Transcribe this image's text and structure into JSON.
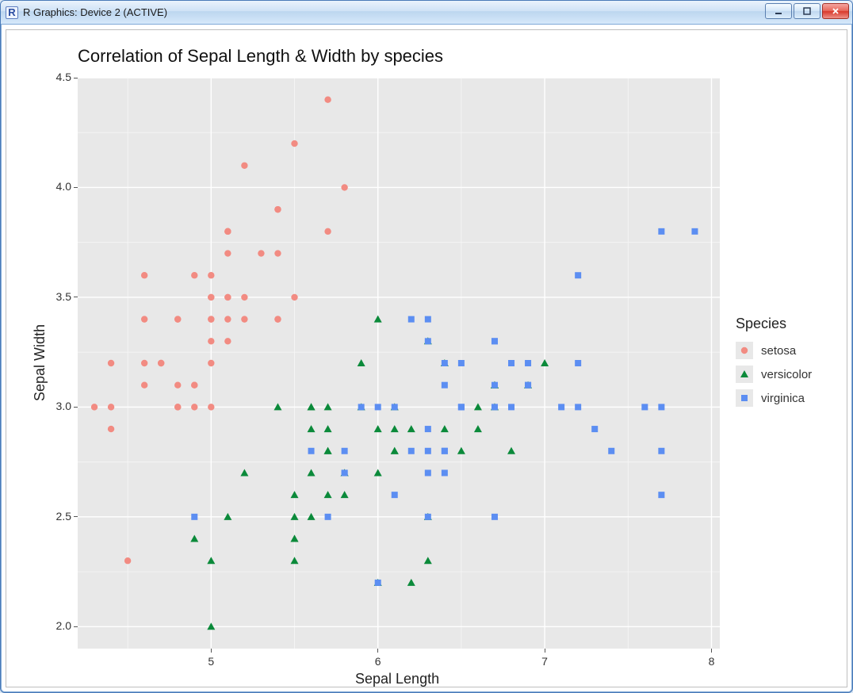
{
  "window": {
    "title": "R Graphics: Device 2 (ACTIVE)",
    "icon_label": "R"
  },
  "chart_data": {
    "type": "scatter",
    "title": "Correlation of Sepal Length & Width by species",
    "xlabel": "Sepal Length",
    "ylabel": "Sepal Width",
    "xlim": [
      4.2,
      8.05
    ],
    "ylim": [
      1.9,
      4.5
    ],
    "x_ticks": [
      5,
      6,
      7,
      8
    ],
    "x_tick_labels": [
      "5",
      "6",
      "7",
      "8"
    ],
    "y_ticks": [
      2.0,
      2.5,
      3.0,
      3.5,
      4.0,
      4.5
    ],
    "y_tick_labels": [
      "2.0",
      "2.5",
      "3.0",
      "3.5",
      "4.0",
      "4.5"
    ],
    "x_minor": [
      4.5,
      5.5,
      6.5,
      7.5
    ],
    "y_minor": [
      2.25,
      2.75,
      3.25,
      3.75,
      4.25
    ],
    "legend_title": "Species",
    "legend_position": "right",
    "series": [
      {
        "name": "setosa",
        "shape": "circle",
        "color": "#f28b82",
        "points": [
          [
            5.1,
            3.5
          ],
          [
            4.9,
            3.0
          ],
          [
            4.7,
            3.2
          ],
          [
            4.6,
            3.1
          ],
          [
            5.0,
            3.6
          ],
          [
            5.4,
            3.9
          ],
          [
            4.6,
            3.4
          ],
          [
            5.0,
            3.4
          ],
          [
            4.4,
            2.9
          ],
          [
            4.9,
            3.1
          ],
          [
            5.4,
            3.7
          ],
          [
            4.8,
            3.4
          ],
          [
            4.8,
            3.0
          ],
          [
            4.3,
            3.0
          ],
          [
            5.8,
            4.0
          ],
          [
            5.7,
            4.4
          ],
          [
            5.4,
            3.9
          ],
          [
            5.1,
            3.5
          ],
          [
            5.7,
            3.8
          ],
          [
            5.1,
            3.8
          ],
          [
            5.4,
            3.4
          ],
          [
            5.1,
            3.7
          ],
          [
            4.6,
            3.6
          ],
          [
            5.1,
            3.3
          ],
          [
            4.8,
            3.4
          ],
          [
            5.0,
            3.0
          ],
          [
            5.0,
            3.4
          ],
          [
            5.2,
            3.5
          ],
          [
            5.2,
            3.4
          ],
          [
            4.7,
            3.2
          ],
          [
            4.8,
            3.1
          ],
          [
            5.4,
            3.4
          ],
          [
            5.2,
            4.1
          ],
          [
            5.5,
            4.2
          ],
          [
            4.9,
            3.1
          ],
          [
            5.0,
            3.2
          ],
          [
            5.5,
            3.5
          ],
          [
            4.9,
            3.6
          ],
          [
            4.4,
            3.0
          ],
          [
            5.1,
            3.4
          ],
          [
            5.0,
            3.5
          ],
          [
            4.5,
            2.3
          ],
          [
            4.4,
            3.2
          ],
          [
            5.0,
            3.5
          ],
          [
            5.1,
            3.8
          ],
          [
            4.8,
            3.0
          ],
          [
            5.1,
            3.8
          ],
          [
            4.6,
            3.2
          ],
          [
            5.3,
            3.7
          ],
          [
            5.0,
            3.3
          ]
        ]
      },
      {
        "name": "versicolor",
        "shape": "triangle",
        "color": "#0b8a3a",
        "points": [
          [
            7.0,
            3.2
          ],
          [
            6.4,
            3.2
          ],
          [
            6.9,
            3.1
          ],
          [
            5.5,
            2.3
          ],
          [
            6.5,
            2.8
          ],
          [
            5.7,
            2.8
          ],
          [
            6.3,
            3.3
          ],
          [
            4.9,
            2.4
          ],
          [
            6.6,
            2.9
          ],
          [
            5.2,
            2.7
          ],
          [
            5.0,
            2.0
          ],
          [
            5.9,
            3.0
          ],
          [
            6.0,
            2.2
          ],
          [
            6.1,
            2.9
          ],
          [
            5.6,
            2.9
          ],
          [
            6.7,
            3.1
          ],
          [
            5.6,
            3.0
          ],
          [
            5.8,
            2.7
          ],
          [
            6.2,
            2.2
          ],
          [
            5.6,
            2.5
          ],
          [
            5.9,
            3.2
          ],
          [
            6.1,
            2.8
          ],
          [
            6.3,
            2.5
          ],
          [
            6.1,
            2.8
          ],
          [
            6.4,
            2.9
          ],
          [
            6.6,
            3.0
          ],
          [
            6.8,
            2.8
          ],
          [
            6.7,
            3.0
          ],
          [
            6.0,
            2.9
          ],
          [
            5.7,
            2.6
          ],
          [
            5.5,
            2.4
          ],
          [
            5.5,
            2.4
          ],
          [
            5.8,
            2.7
          ],
          [
            6.0,
            2.7
          ],
          [
            5.4,
            3.0
          ],
          [
            6.0,
            3.4
          ],
          [
            6.7,
            3.1
          ],
          [
            6.3,
            2.3
          ],
          [
            5.6,
            3.0
          ],
          [
            5.5,
            2.5
          ],
          [
            5.5,
            2.6
          ],
          [
            6.1,
            3.0
          ],
          [
            5.8,
            2.6
          ],
          [
            5.0,
            2.3
          ],
          [
            5.6,
            2.7
          ],
          [
            5.7,
            3.0
          ],
          [
            5.7,
            2.9
          ],
          [
            6.2,
            2.9
          ],
          [
            5.1,
            2.5
          ],
          [
            5.7,
            2.8
          ]
        ]
      },
      {
        "name": "virginica",
        "shape": "square",
        "color": "#5c8ef2",
        "points": [
          [
            6.3,
            3.3
          ],
          [
            5.8,
            2.7
          ],
          [
            7.1,
            3.0
          ],
          [
            6.3,
            2.9
          ],
          [
            6.5,
            3.0
          ],
          [
            7.6,
            3.0
          ],
          [
            4.9,
            2.5
          ],
          [
            7.3,
            2.9
          ],
          [
            6.7,
            2.5
          ],
          [
            7.2,
            3.6
          ],
          [
            6.5,
            3.2
          ],
          [
            6.4,
            2.7
          ],
          [
            6.8,
            3.0
          ],
          [
            5.7,
            2.5
          ],
          [
            5.8,
            2.8
          ],
          [
            6.4,
            3.2
          ],
          [
            6.5,
            3.0
          ],
          [
            7.7,
            3.8
          ],
          [
            7.7,
            2.6
          ],
          [
            6.0,
            2.2
          ],
          [
            6.9,
            3.2
          ],
          [
            5.6,
            2.8
          ],
          [
            7.7,
            2.8
          ],
          [
            6.3,
            2.7
          ],
          [
            6.7,
            3.3
          ],
          [
            7.2,
            3.2
          ],
          [
            6.2,
            2.8
          ],
          [
            6.1,
            3.0
          ],
          [
            6.4,
            2.8
          ],
          [
            7.2,
            3.0
          ],
          [
            7.4,
            2.8
          ],
          [
            7.9,
            3.8
          ],
          [
            6.4,
            2.8
          ],
          [
            6.3,
            2.8
          ],
          [
            6.1,
            2.6
          ],
          [
            7.7,
            3.0
          ],
          [
            6.3,
            3.4
          ],
          [
            6.4,
            3.1
          ],
          [
            6.0,
            3.0
          ],
          [
            6.9,
            3.1
          ],
          [
            6.7,
            3.1
          ],
          [
            6.9,
            3.1
          ],
          [
            5.8,
            2.7
          ],
          [
            6.8,
            3.2
          ],
          [
            6.7,
            3.3
          ],
          [
            6.7,
            3.0
          ],
          [
            6.3,
            2.5
          ],
          [
            6.5,
            3.0
          ],
          [
            6.2,
            3.4
          ],
          [
            5.9,
            3.0
          ]
        ]
      }
    ]
  }
}
